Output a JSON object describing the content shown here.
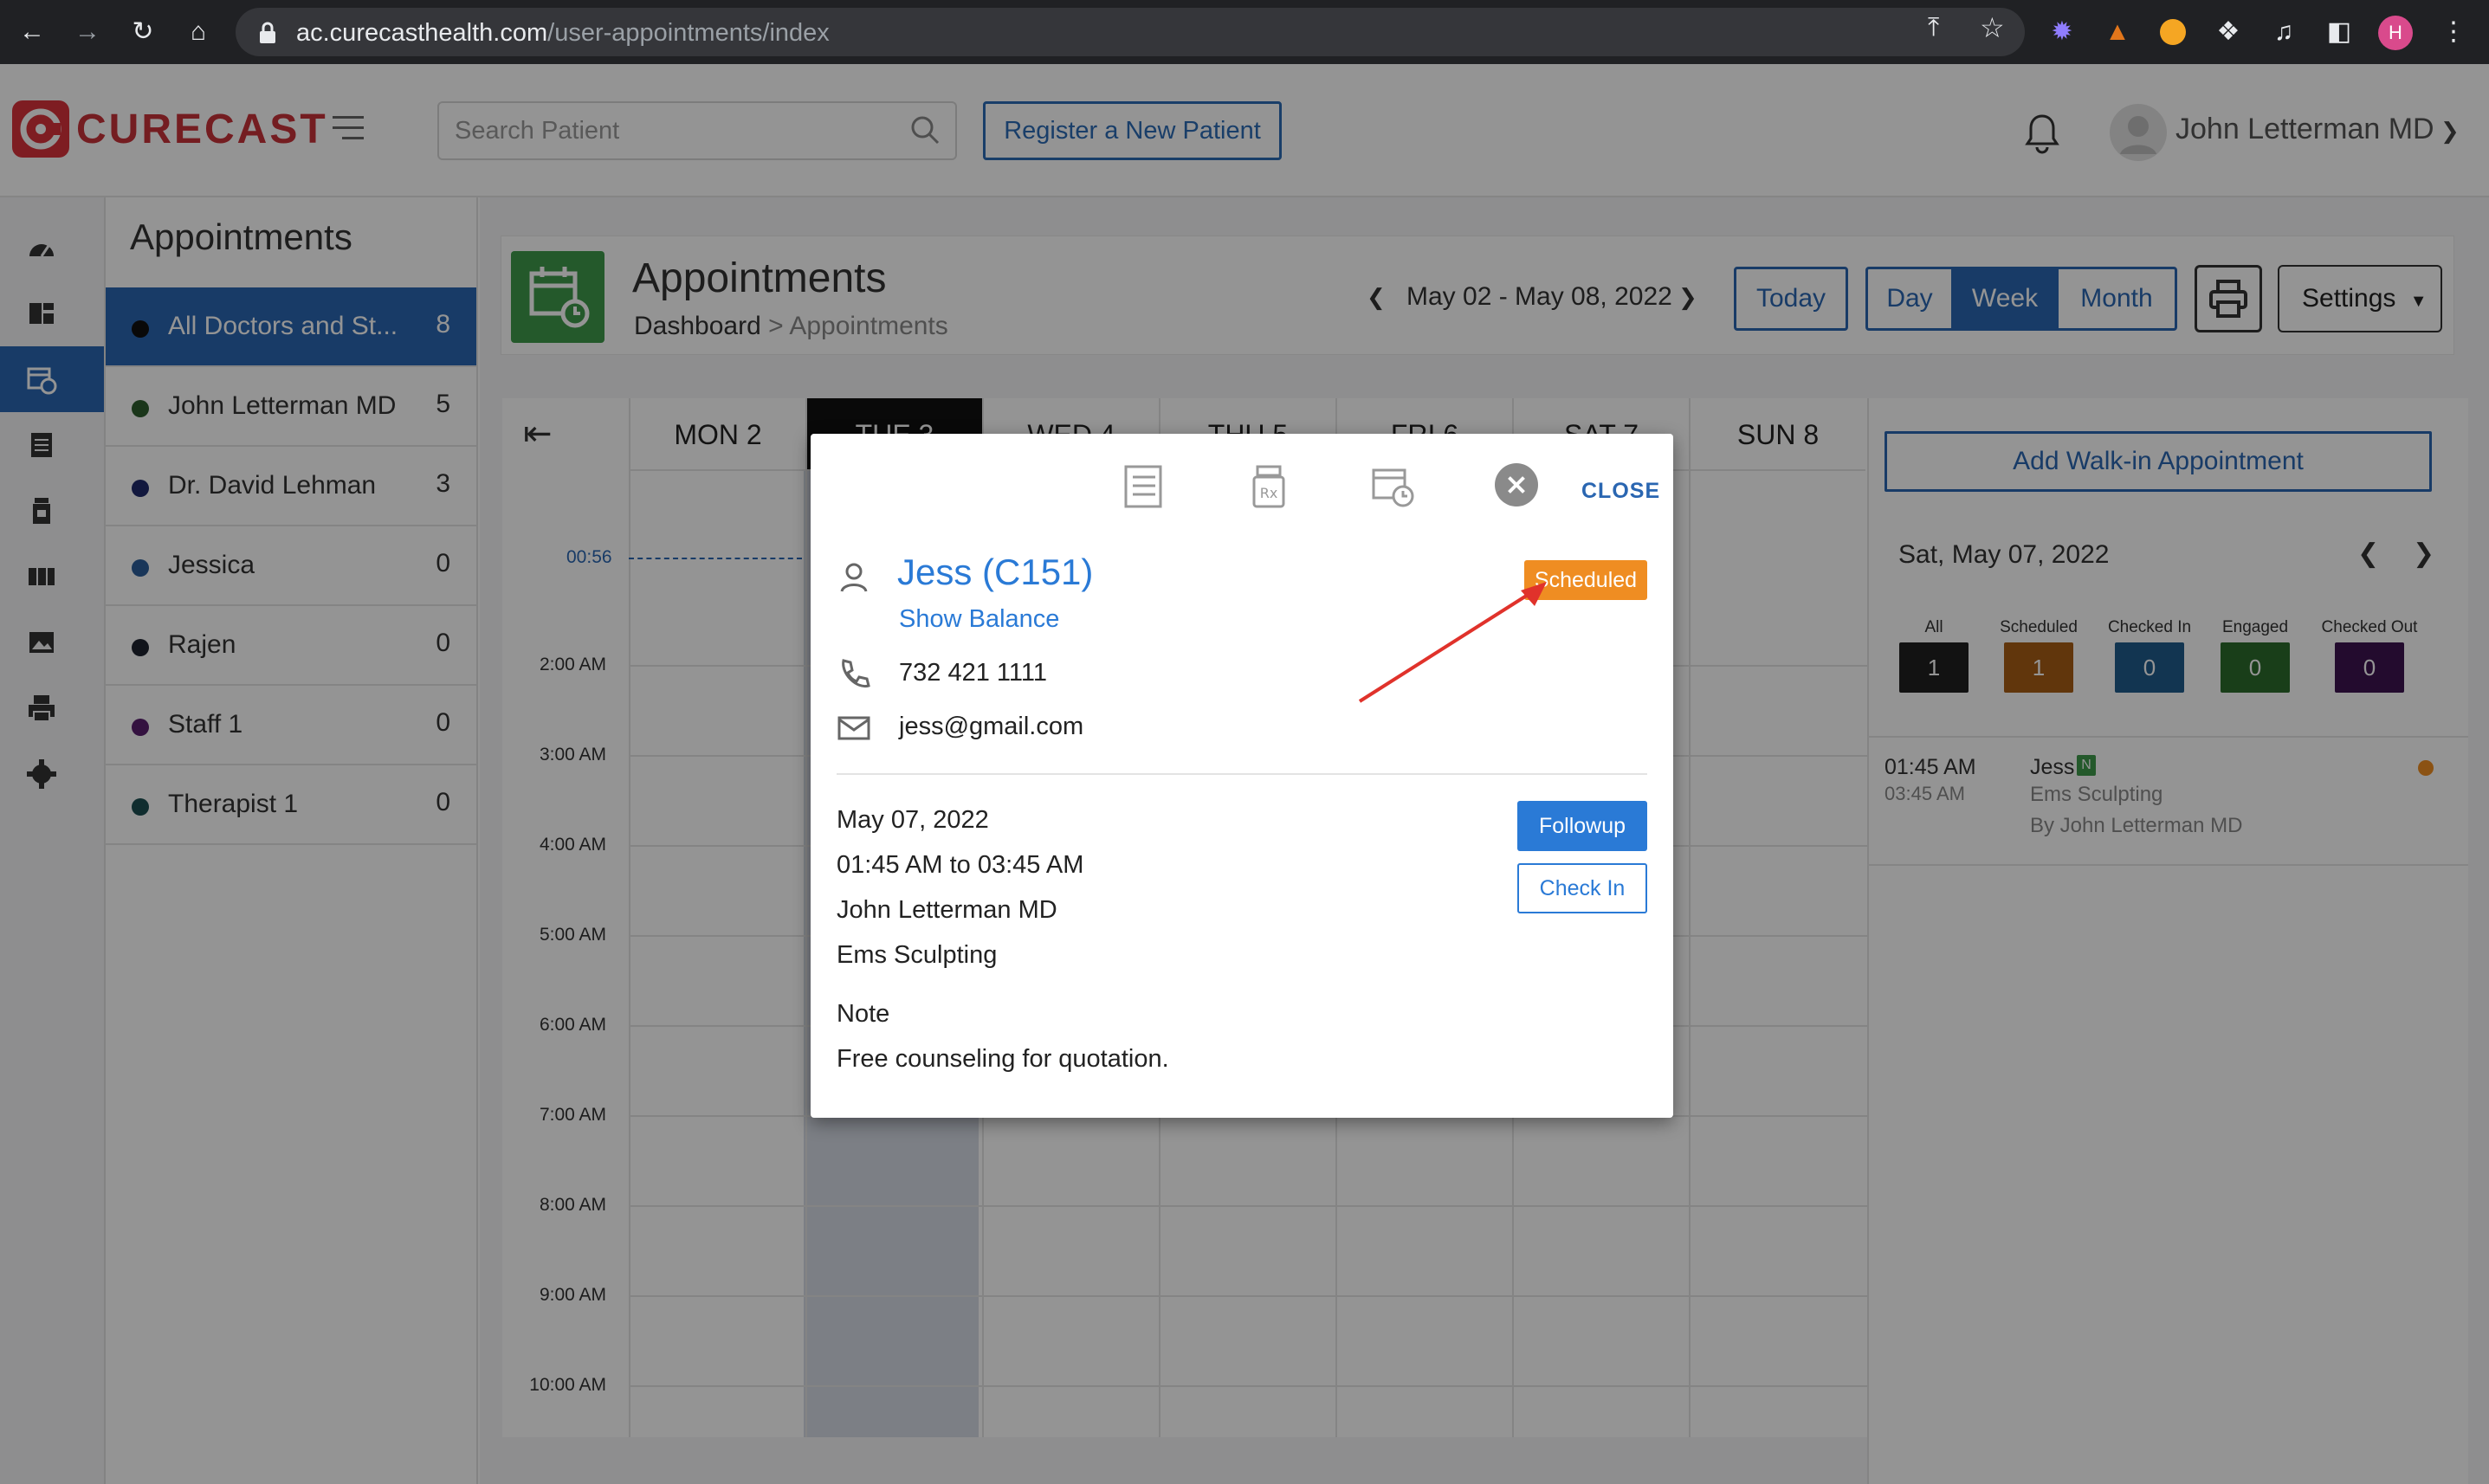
{
  "browser": {
    "url_domain": "ac.curecasthealth.com",
    "url_path": "/user-appointments/index",
    "profile_initial": "H"
  },
  "header": {
    "logo": "CURECAST",
    "search_placeholder": "Search Patient",
    "register_button": "Register a New Patient",
    "user_name": "John Letterman MD"
  },
  "sidebar": {
    "title": "Appointments",
    "doctors": [
      {
        "name": "All Doctors and St...",
        "count": "8",
        "color": "#111111"
      },
      {
        "name": "John Letterman MD",
        "count": "5",
        "color": "#2e5e2e"
      },
      {
        "name": "Dr. David Lehman",
        "count": "3",
        "color": "#1f2a6b"
      },
      {
        "name": "Jessica",
        "count": "0",
        "color": "#2b5e9a"
      },
      {
        "name": "Rajen",
        "count": "0",
        "color": "#1e2430"
      },
      {
        "name": "Staff 1",
        "count": "0",
        "color": "#5a1f6e"
      },
      {
        "name": "Therapist 1",
        "count": "0",
        "color": "#1c4f52"
      }
    ]
  },
  "page": {
    "title": "Appointments",
    "breadcrumb_home": "Dashboard",
    "breadcrumb_sep": ">",
    "breadcrumb_current": "Appointments",
    "date_range": "May 02 - May 08, 2022",
    "today_button": "Today",
    "view_day": "Day",
    "view_week": "Week",
    "view_month": "Month",
    "settings_button": "Settings"
  },
  "calendar": {
    "days": [
      "MON 2",
      "TUE 3",
      "WED 4",
      "THU 5",
      "FRI 6",
      "SAT 7",
      "SUN 8"
    ],
    "current_time": "00:56",
    "hours": [
      "2:00 AM",
      "3:00 AM",
      "4:00 AM",
      "5:00 AM",
      "6:00 AM",
      "7:00 AM",
      "8:00 AM",
      "9:00 AM",
      "10:00 AM"
    ]
  },
  "right_panel": {
    "walkin_button": "Add Walk-in Appointment",
    "date": "Sat, May 07, 2022",
    "stats": [
      {
        "label": "All",
        "value": "1",
        "color": "#1f1f1f"
      },
      {
        "label": "Scheduled",
        "value": "1",
        "color": "#a85e16"
      },
      {
        "label": "Checked In",
        "value": "0",
        "color": "#1f5c8c"
      },
      {
        "label": "Engaged",
        "value": "0",
        "color": "#2b6b2b"
      },
      {
        "label": "Checked Out",
        "value": "0",
        "color": "#3d1350"
      }
    ],
    "appointment": {
      "start": "01:45 AM",
      "end": "03:45 AM",
      "patient": "Jess",
      "badge": "N",
      "service": "Ems Sculpting",
      "by": "By John Letterman MD"
    }
  },
  "modal": {
    "close_label": "CLOSE",
    "patient_name": "Jess (C151)",
    "show_balance": "Show Balance",
    "status": "Scheduled",
    "phone": "732 421 1111",
    "email": "jess@gmail.com",
    "date": "May 07, 2022",
    "time": "01:45 AM to 03:45 AM",
    "provider": "John Letterman MD",
    "service": "Ems Sculpting",
    "note_label": "Note",
    "note": "Free counseling for quotation.",
    "followup_button": "Followup",
    "checkin_button": "Check In"
  }
}
